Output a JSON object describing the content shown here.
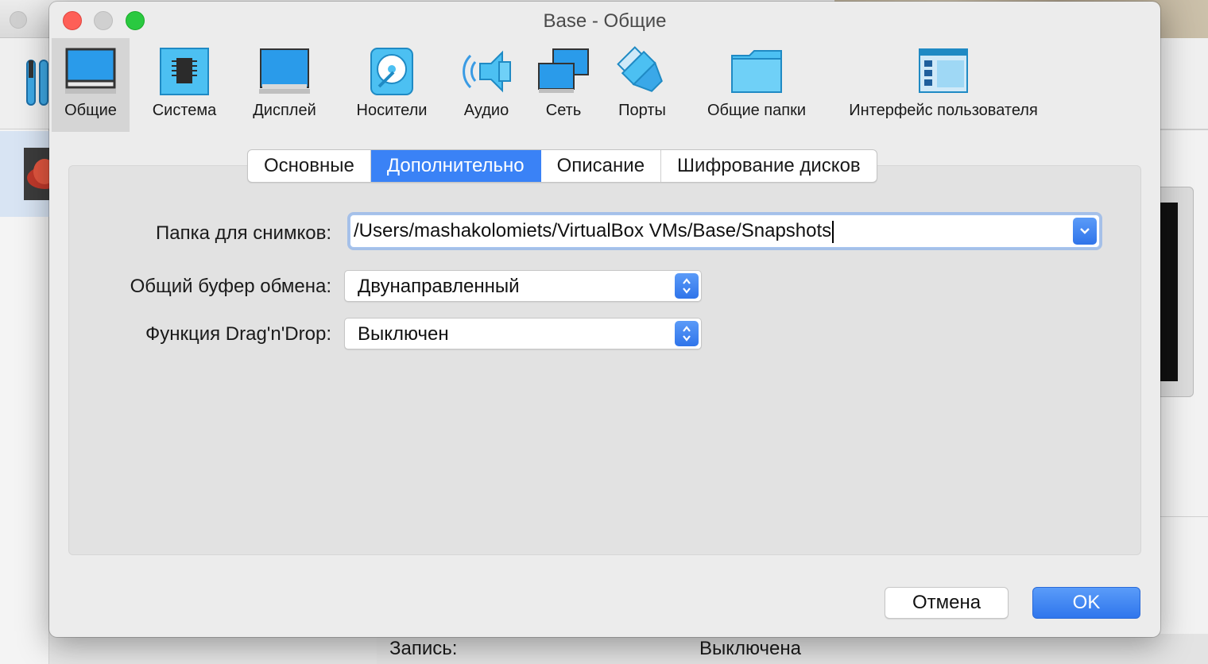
{
  "dialog": {
    "title": "Base - Общие",
    "categories": [
      {
        "label": "Общие",
        "icon": "general-monitor-icon",
        "selected": true
      },
      {
        "label": "Система",
        "icon": "system-chip-icon"
      },
      {
        "label": "Дисплей",
        "icon": "display-monitor-icon"
      },
      {
        "label": "Носители",
        "icon": "storage-disk-icon"
      },
      {
        "label": "Аудио",
        "icon": "audio-speaker-icon"
      },
      {
        "label": "Сеть",
        "icon": "network-icon"
      },
      {
        "label": "Порты",
        "icon": "ports-icon"
      },
      {
        "label": "Общие папки",
        "icon": "shared-folder-icon"
      },
      {
        "label": "Интерфейс пользователя",
        "icon": "user-interface-icon"
      }
    ],
    "tabs": [
      {
        "label": "Основные"
      },
      {
        "label": "Дополнительно",
        "active": true
      },
      {
        "label": "Описание"
      },
      {
        "label": "Шифрование дисков"
      }
    ],
    "form": {
      "snapshot_folder_label": "Папка для снимков:",
      "snapshot_folder_value": "/Users/mashakolomiets/VirtualBox VMs/Base/Snapshots",
      "clipboard_label": "Общий буфер обмена:",
      "clipboard_value": "Двунаправленный",
      "dragdrop_label": "Функция Drag'n'Drop:",
      "dragdrop_value": "Выключен"
    },
    "buttons": {
      "cancel": "Отмена",
      "ok": "OK"
    }
  },
  "background": {
    "recording_label": "Запись:",
    "recording_value": "Выключена"
  },
  "colors": {
    "accent": "#3a82f6",
    "close": "#fe5f57",
    "maximize": "#2ac940"
  }
}
